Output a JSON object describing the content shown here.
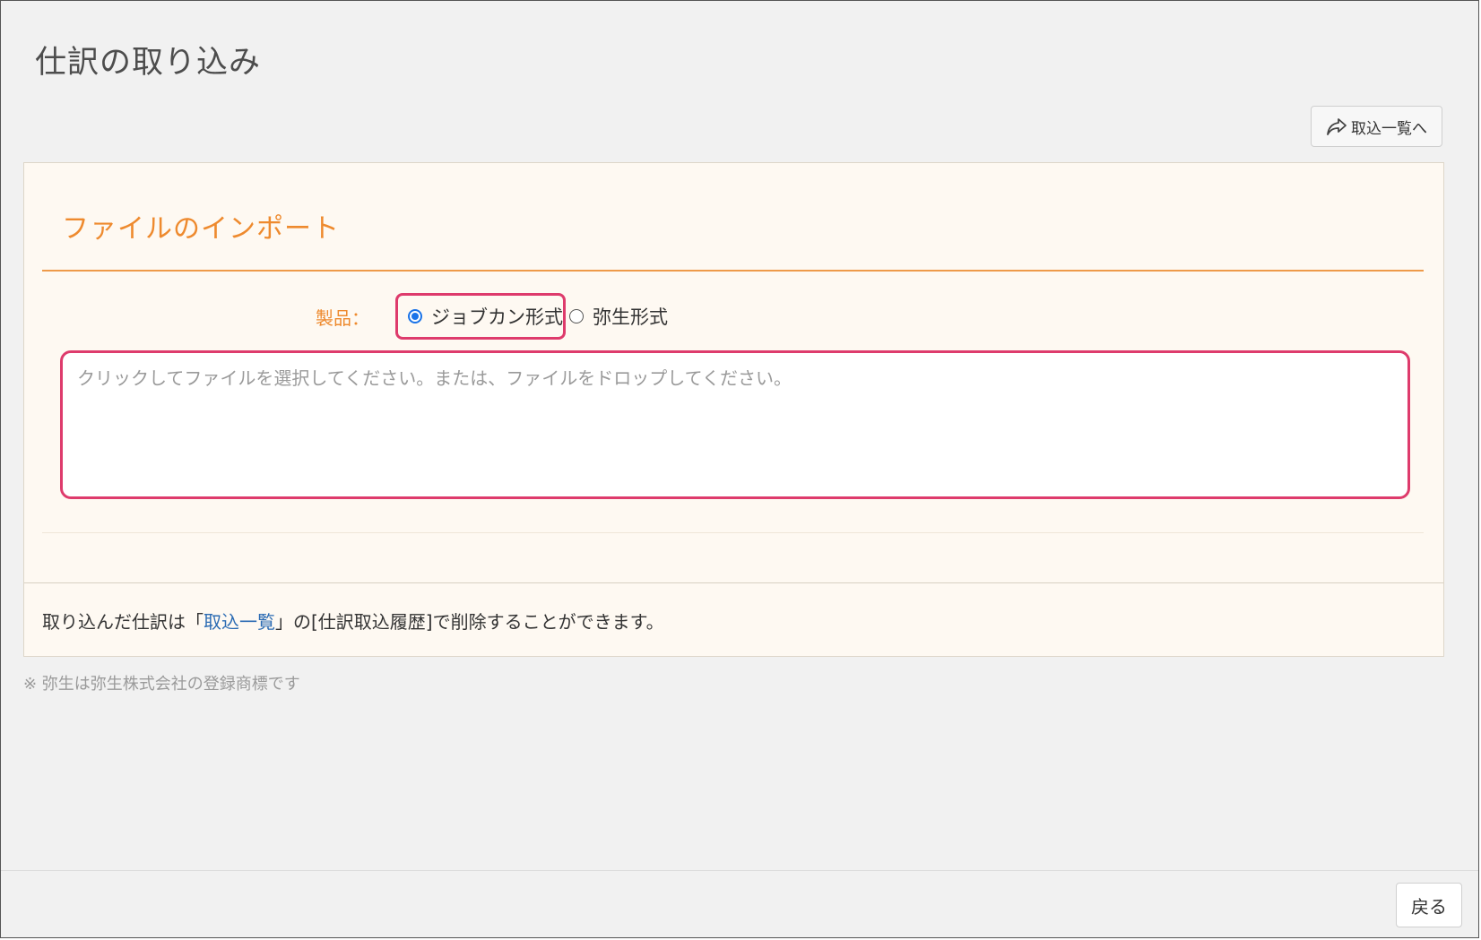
{
  "page": {
    "title": "仕訳の取り込み"
  },
  "toolbar": {
    "list_button_label": "取込一覧へ",
    "list_button_icon": "share-arrow-icon"
  },
  "import_section": {
    "title": "ファイルのインポート",
    "product_label": "製品：",
    "options": [
      {
        "label": "ジョブカン形式",
        "selected": true
      },
      {
        "label": "弥生形式",
        "selected": false
      }
    ],
    "dropzone_placeholder": "クリックしてファイルを選択してください。または、ファイルをドロップしてください。",
    "highlight_color": "#de3b6c"
  },
  "footer_note": {
    "prefix": "取り込んだ仕訳は「",
    "link": "取込一覧",
    "suffix": "」の[仕訳取込履歴]で削除することができます。"
  },
  "trademark_note": "※ 弥生は弥生株式会社の登録商標です",
  "bottom": {
    "back_button_label": "戻る"
  },
  "colors": {
    "accent_orange": "#ee8a2e",
    "link_blue": "#2b6bb3",
    "radio_blue": "#1a73e8"
  }
}
